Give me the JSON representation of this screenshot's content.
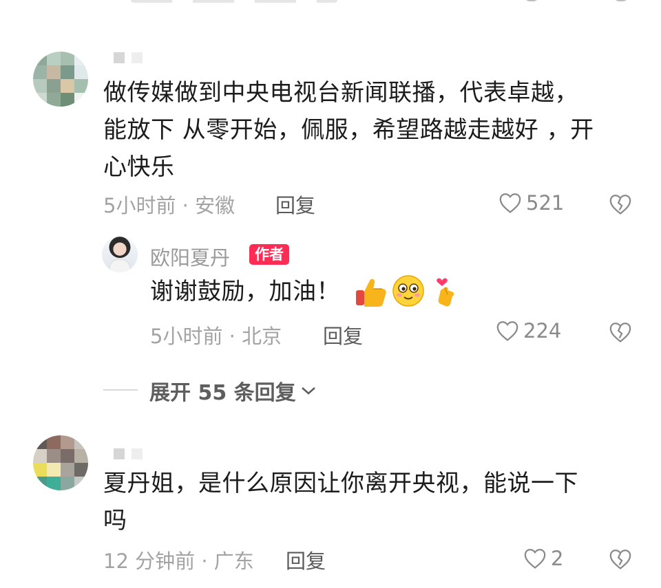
{
  "comments": [
    {
      "text": "做传媒做到中央电视台新闻联播，代表卓越，\n能放下 从零开始，佩服，希望路越走越好 ，开\n心快乐",
      "time_location": "5小时前 · 安徽",
      "reply_label": "回复",
      "likes": "521",
      "author_reply": {
        "name": "欧阳夏丹",
        "badge": "作者",
        "text": "谢谢鼓励，加油！",
        "emojis": [
          "thumbs-up-icon",
          "blushing-face-icon",
          "finger-heart-icon"
        ],
        "time_location": "5小时前 · 北京",
        "reply_label": "回复",
        "likes": "224"
      },
      "expand_label": "展开 55 条回复"
    },
    {
      "text": "夏丹姐，是什么原因让你离开央视，能说一下\n吗",
      "time_location": "12 分钟前 · 广东",
      "reply_label": "回复",
      "likes": "2"
    }
  ],
  "colors": {
    "badge": "#fe2c55",
    "meta": "#a3a3a3",
    "text": "#1c1c1c"
  }
}
